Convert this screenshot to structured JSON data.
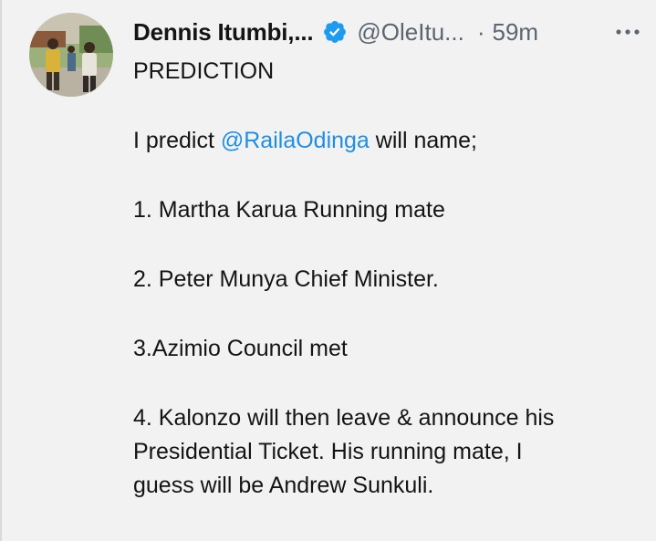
{
  "tweet": {
    "author_name": "Dennis Itumbi,...",
    "handle": "@OleItu...",
    "separator": "·",
    "time": "59m",
    "more_icon": "more-horizontal-icon",
    "verified_icon": "verified-badge-icon",
    "colors": {
      "mention": "#1d8fe8",
      "verified": "#1d9bf0",
      "muted": "#5b6670",
      "text": "#141414",
      "background": "#f2f2f2"
    },
    "text": {
      "line_1": "PREDICTION",
      "line_2_prefix": "I predict ",
      "line_2_mention": "@RailaOdinga",
      "line_2_suffix": " will name;",
      "item_1": "1. Martha Karua Running mate",
      "item_2": "2. Peter Munya Chief Minister.",
      "item_3": "3.Azimio Council met",
      "item_4_line_1": "4. Kalonzo will then leave & announce his",
      "item_4_line_2": "Presidential Ticket. His running mate, I",
      "item_4_line_3": "guess will be Andrew Sunkuli."
    }
  }
}
